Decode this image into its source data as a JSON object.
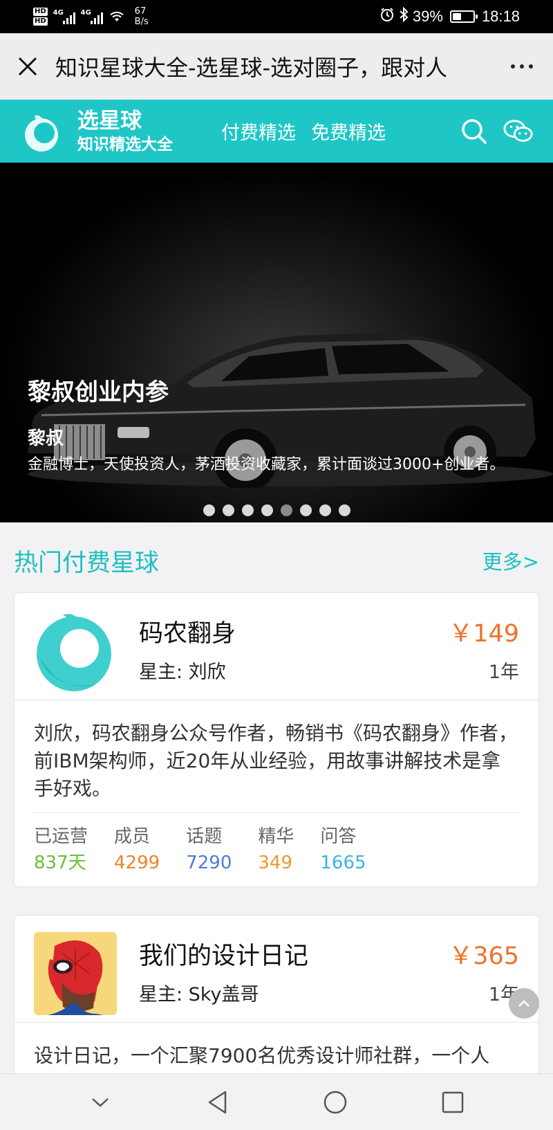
{
  "status_bar": {
    "hd1": "HD",
    "hd2": "HD",
    "net1": "4G",
    "net2": "4G",
    "speed_value": "67",
    "speed_unit": "B/s",
    "battery_percent": "39%",
    "battery_level": 0.39,
    "time": "18:18"
  },
  "webview": {
    "title": "知识星球大全-选星球-选对圈子，跟对人"
  },
  "site_header": {
    "brand_name": "选星球",
    "brand_sub": "知识精选大全",
    "nav": [
      "付费精选",
      "免费精选"
    ]
  },
  "banner": {
    "title": "黎叔创业内参",
    "author": "黎叔",
    "description": "金融博士，天使投资人，茅酒投资收藏家，累计面谈过3000+创业者。",
    "slide_count": 8,
    "active_slide": 4
  },
  "section": {
    "title": "热门付费星球",
    "more": "更多>"
  },
  "cards": [
    {
      "name": "码农翻身",
      "owner": "星主: 刘欣",
      "price": "￥149",
      "period": "1年",
      "description": "刘欣，码农翻身公众号作者，畅销书《码农翻身》作者，前IBM架构师，近20年从业经验，用故事讲解技术是拿手好戏。",
      "stats": [
        {
          "label": "已运营",
          "value": "837天",
          "color": "#6abf3c"
        },
        {
          "label": "成员",
          "value": "4299",
          "color": "#f0822a"
        },
        {
          "label": "话题",
          "value": "7290",
          "color": "#4a7ed8"
        },
        {
          "label": "精华",
          "value": "349",
          "color": "#f09a2a"
        },
        {
          "label": "问答",
          "value": "1665",
          "color": "#3ab3e0"
        }
      ]
    },
    {
      "name": "我们的设计日记",
      "owner": "星主: Sky盖哥",
      "price": "￥365",
      "period": "1年",
      "description": "设计日记，一个汇聚7900名优秀设计师社群，一个人"
    }
  ],
  "colors": {
    "brand": "#1fc6c6",
    "price": "#f0712a"
  }
}
